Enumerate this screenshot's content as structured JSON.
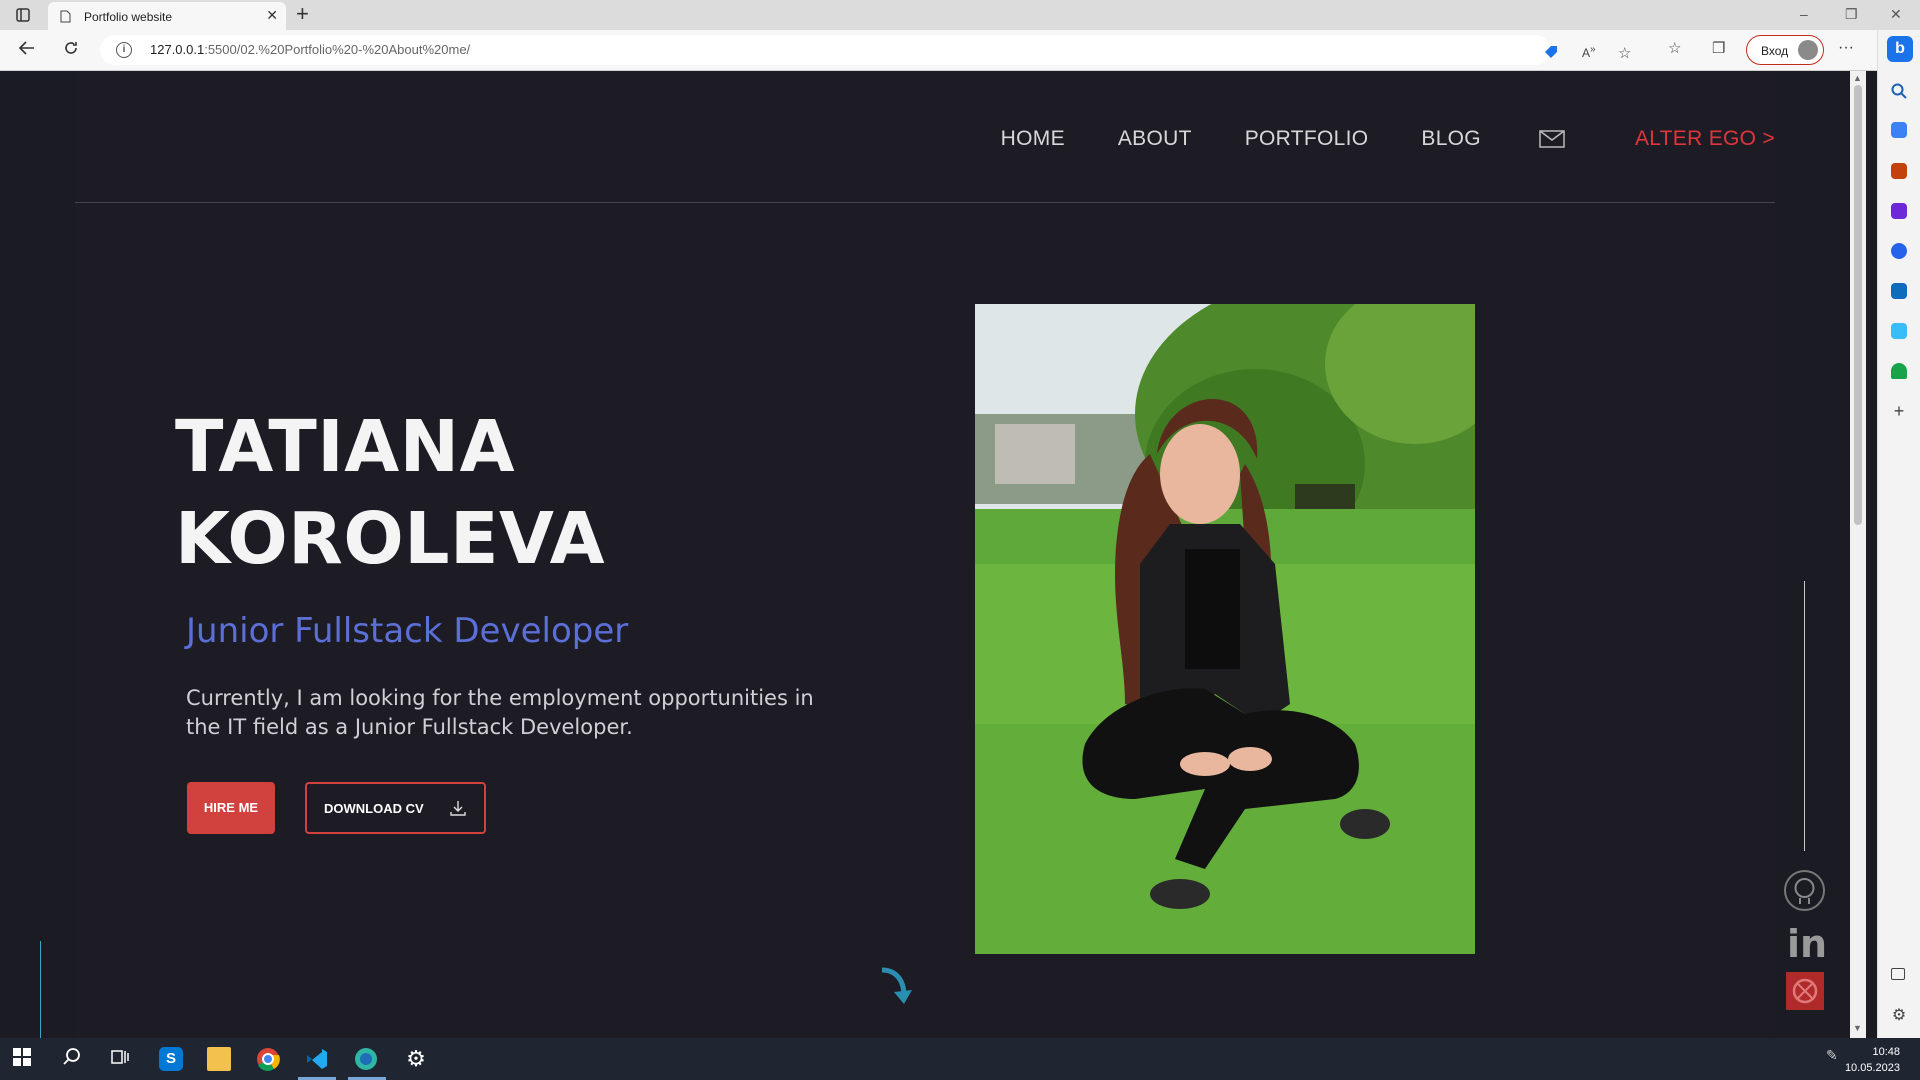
{
  "browser": {
    "tab_title": "Portfolio website",
    "tab_close": "✕",
    "new_tab": "+",
    "url_host": "127.0.0.1",
    "url_path": ":5500/02.%20Portfolio%20-%20About%20me/",
    "login_label": "Вход",
    "more_label": "···",
    "window_controls": [
      "–",
      "❐",
      "✕"
    ]
  },
  "nav": {
    "items": [
      "HOME",
      "ABOUT",
      "PORTFOLIO",
      "BLOG"
    ],
    "mail_icon": "mail-icon",
    "alter_ego": "ALTER EGO >"
  },
  "hero": {
    "first_name": "TATIANA",
    "last_name": "KOROLEVA",
    "role": "Junior Fullstack Developer",
    "description": "Currently, I am looking for the employment opportunities in the IT field as a Junior Fullstack Developer.",
    "hire_button": "HIRE ME",
    "cv_button": "DOWNLOAD CV"
  },
  "social": [
    "github-icon",
    "linkedin-icon",
    "codewars-icon"
  ],
  "taskbar": {
    "time": "10:48",
    "date": "10.05.2023"
  },
  "colors": {
    "accent_red": "#d1423f",
    "role_blue": "#5b6fd6",
    "alter_red": "#e0353b",
    "page_bg": "#1d1c25"
  }
}
